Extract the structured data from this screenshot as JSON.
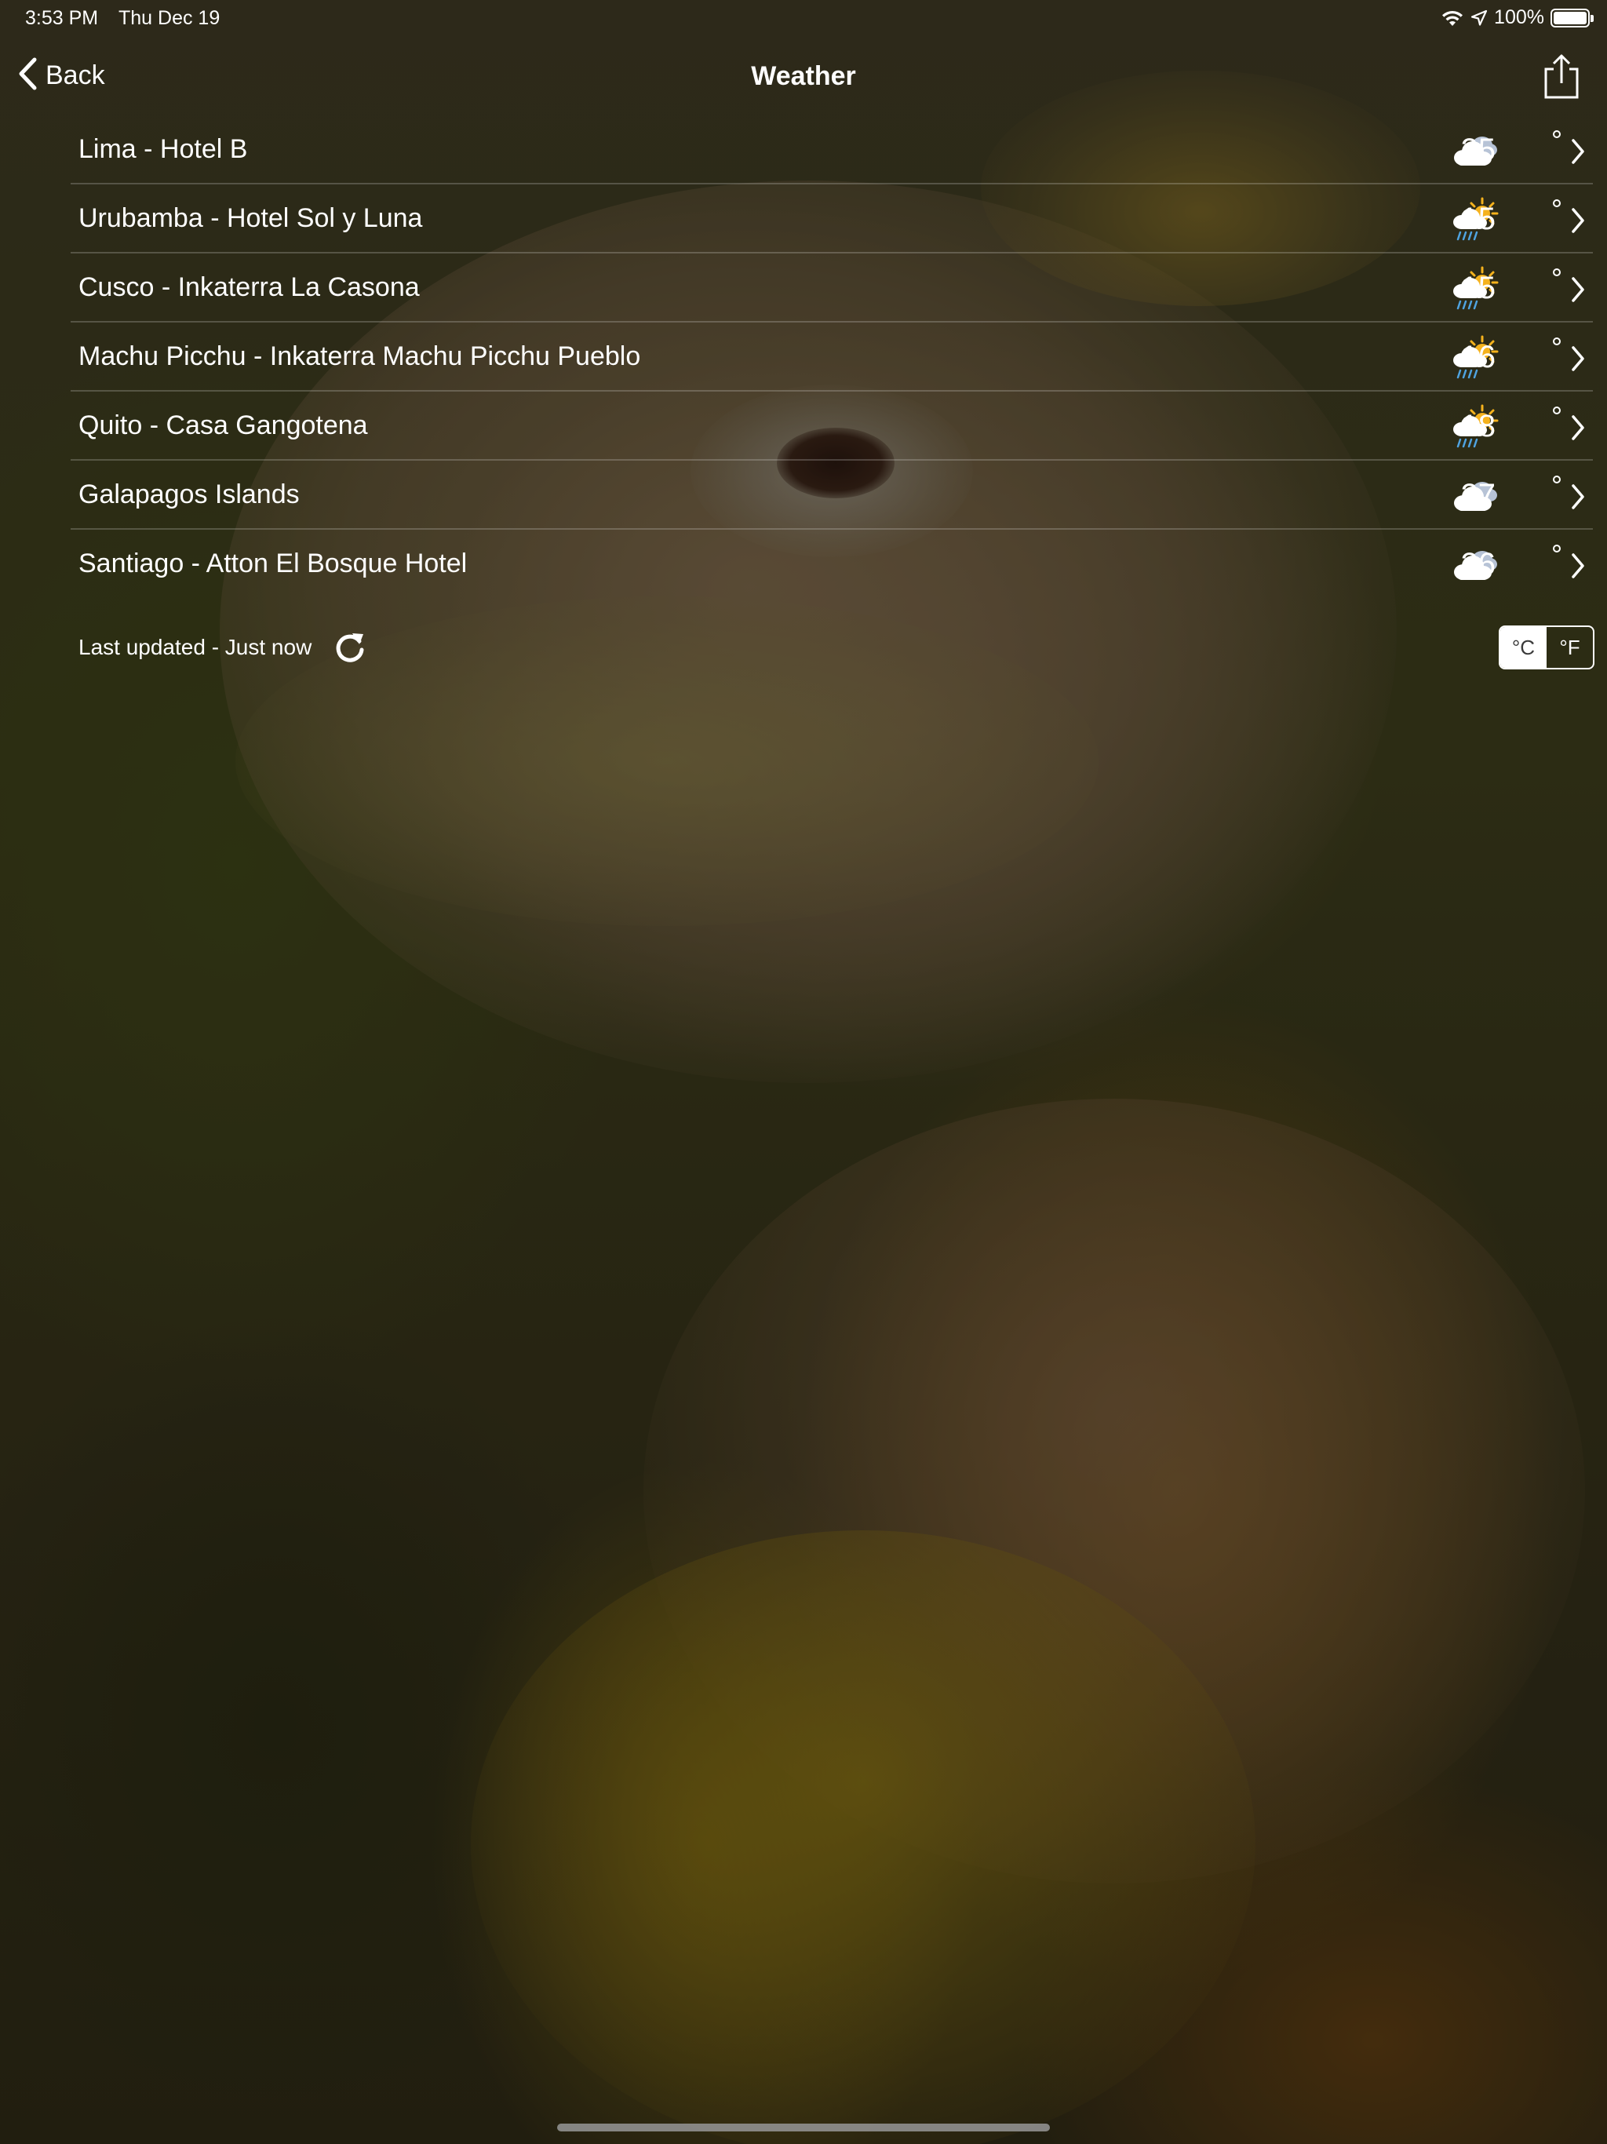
{
  "status_bar": {
    "time": "3:53 PM",
    "date": "Thu Dec 19",
    "battery_percent": "100%",
    "battery_level": 1.0,
    "icons": [
      "wifi-icon",
      "location-arrow-icon",
      "battery-icon"
    ]
  },
  "nav": {
    "back_label": "Back",
    "title": "Weather",
    "share_icon": "share-icon"
  },
  "locations": [
    {
      "name": "Lima - Hotel B",
      "temp": "25",
      "condition": "cloudy"
    },
    {
      "name": "Urubamba - Hotel Sol y Luna",
      "temp": "15",
      "condition": "sun-rain"
    },
    {
      "name": "Cusco - Inkaterra La Casona",
      "temp": "15",
      "condition": "sun-rain"
    },
    {
      "name": "Machu Picchu - Inkaterra Machu Picchu Pueblo",
      "temp": "16",
      "condition": "sun-rain"
    },
    {
      "name": "Quito - Casa Gangotena",
      "temp": "18",
      "condition": "sun-rain"
    },
    {
      "name": "Galapagos Islands",
      "temp": "27",
      "condition": "cloudy"
    },
    {
      "name": "Santiago - Atton El Bosque Hotel",
      "temp": "26",
      "condition": "cloudy"
    }
  ],
  "footer": {
    "updated_text": "Last updated - Just now",
    "unit_celsius": "°C",
    "unit_fahrenheit": "°F",
    "selected_unit": "celsius"
  },
  "colors": {
    "text": "#ffffff",
    "sun": "#f5b21d",
    "rain": "#4fa3e0",
    "cloud_front": "#ffffff",
    "cloud_back": "#b7c3d6"
  }
}
